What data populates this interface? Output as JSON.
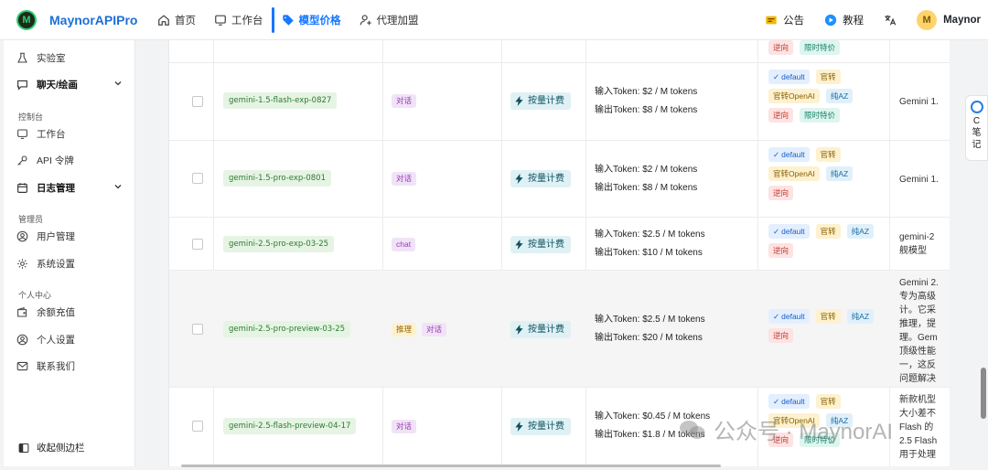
{
  "header": {
    "logo_text": "M",
    "brand": "MaynorAPIPro",
    "nav": [
      {
        "label": "首页"
      },
      {
        "label": "工作台"
      },
      {
        "label": "模型价格"
      },
      {
        "label": "代理加盟"
      }
    ],
    "announce": "公告",
    "tutorial": "教程",
    "avatar_initial": "M",
    "user_name": "Maynor"
  },
  "sidebar": {
    "lab": "实验室",
    "chat_draw": "聊天/绘画",
    "group_console": "控制台",
    "workbench": "工作台",
    "api_token": "API 令牌",
    "log_mgmt": "日志管理",
    "group_admin": "管理员",
    "user_mgmt": "用户管理",
    "sys_settings": "系统设置",
    "group_personal": "个人中心",
    "recharge": "余额充值",
    "personal_settings": "个人设置",
    "contact": "联系我们",
    "collapse": "收起侧边栏"
  },
  "top_row": {
    "tags": [
      "逆向",
      "限时特价"
    ]
  },
  "rows": [
    {
      "model": "gemini-1.5-flash-exp-0827",
      "types": [
        "对话"
      ],
      "billing": "按量计费",
      "input_price": "输入Token: $2 / M tokens",
      "output_price": "输出Token: $8 / M tokens",
      "badges": [
        "default",
        "官转",
        "官转OpenAI",
        "纯AZ",
        "逆向",
        "限时特价"
      ],
      "desc": [
        "Gemini 1."
      ]
    },
    {
      "model": "gemini-1.5-pro-exp-0801",
      "types": [
        "对话"
      ],
      "billing": "按量计费",
      "input_price": "输入Token: $2 / M tokens",
      "output_price": "输出Token: $8 / M tokens",
      "badges": [
        "default",
        "官转",
        "官转OpenAI",
        "纯AZ",
        "逆向"
      ],
      "desc": [
        "Gemini 1."
      ]
    },
    {
      "model": "gemini-2.5-pro-exp-03-25",
      "types": [
        "chat"
      ],
      "billing": "按量计费",
      "input_price": "输入Token: $2.5 / M tokens",
      "output_price": "输出Token: $10 / M tokens",
      "badges": [
        "default",
        "官转",
        "纯AZ",
        "逆向"
      ],
      "desc": [
        "gemini-2",
        "舰模型"
      ]
    },
    {
      "model": "gemini-2.5-pro-preview-03-25",
      "types": [
        "推理",
        "对话"
      ],
      "billing": "按量计费",
      "input_price": "输入Token: $2.5 / M tokens",
      "output_price": "输出Token: $20 / M tokens",
      "badges": [
        "default",
        "官转",
        "纯AZ",
        "逆向"
      ],
      "desc": [
        "Gemini 2.",
        "专为高级",
        "计。它采",
        "推理，提",
        "理。Gem",
        "顶级性能",
        "一，这反",
        "问题解决"
      ]
    },
    {
      "model": "gemini-2.5-flash-preview-04-17",
      "types": [
        "对话"
      ],
      "billing": "按量计费",
      "input_price": "输入Token: $0.45 / M tokens",
      "output_price": "输出Token: $1.8 / M tokens",
      "badges": [
        "default",
        "官转",
        "官转OpenAI",
        "纯AZ",
        "逆向",
        "限时特价"
      ],
      "desc": [
        "新款机型",
        "大小差不",
        "Flash 的",
        "2.5 Flash",
        "用于处理"
      ]
    }
  ],
  "float_note": {
    "c": "C",
    "l1": "笔",
    "l2": "记"
  },
  "watermark": {
    "text": "公众号 · MaynorAI"
  },
  "colors": {
    "accent": "#1677ff",
    "brand": "#1d6fd6"
  }
}
